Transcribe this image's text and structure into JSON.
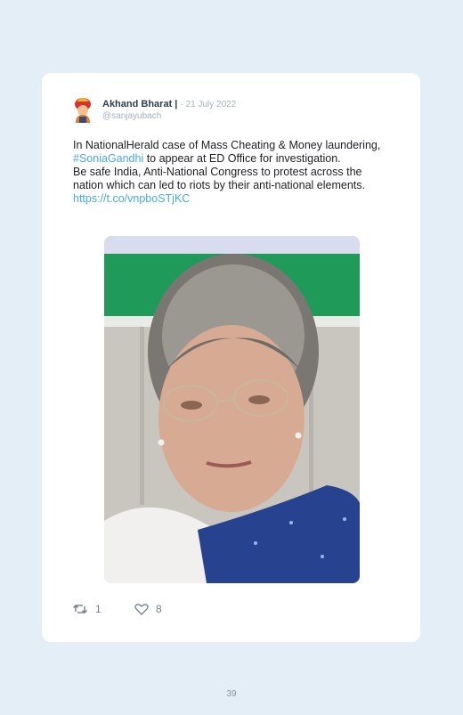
{
  "tweet": {
    "author_name": "Akhand Bharat |",
    "date": "· 21 July 2022",
    "handle": "@sanjayubach",
    "line1": "In NationalHerald case of Mass Cheating & Money laundering, ",
    "hashtag": "#SoniaGandhi",
    "line1_end": " to appear at ED Office for investigation.",
    "line2": "Be safe India, Anti-National Congress to protest across the nation which can led to riots by their anti-national elements.",
    "link": "https://t.co/vnpboSTjKC",
    "retweets": "1",
    "likes": "8"
  },
  "page_number": "39",
  "icons": {
    "avatar": "avatar-icon",
    "retweet": "retweet-icon",
    "like": "heart-icon"
  },
  "colors": {
    "link": "#48a8e8",
    "background": "#e3eef6",
    "card": "#ffffff"
  }
}
